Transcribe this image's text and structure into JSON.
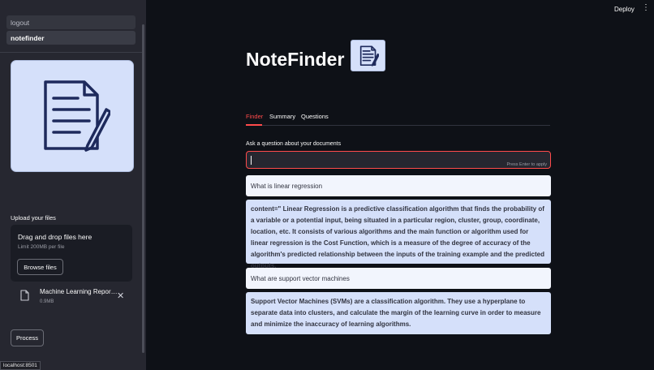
{
  "header": {
    "deploy_label": "Deploy",
    "menu_icon": "kebab-menu-icon"
  },
  "sidebar": {
    "nav": [
      {
        "label": "logout"
      },
      {
        "label": "notefinder"
      }
    ],
    "upload": {
      "label": "Upload your files",
      "dropzone_title": "Drag and drop files here",
      "dropzone_limit": "Limit 200MB per file",
      "browse_label": "Browse files"
    },
    "file": {
      "name": "Machine Learning Repor…",
      "size": "0.9MB"
    },
    "process_label": "Process"
  },
  "main": {
    "title": "NoteFinder",
    "tabs": [
      {
        "label": "Finder",
        "active": true
      },
      {
        "label": "Summary"
      },
      {
        "label": "Questions"
      }
    ],
    "ask": {
      "label": "Ask a question about your documents",
      "hint": "Press Enter to apply",
      "value": ""
    },
    "conversation": [
      {
        "role": "question",
        "text": "What is linear regression"
      },
      {
        "role": "answer",
        "text": "content=\" Linear Regression is a predictive classification algorithm that finds the probability of a variable or a potential input, being situated in a particular region, cluster, group, coordinate, location, etc. It consists of various algorithms and the main function or algorithm used for linear regression is the Cost Function, which is a measure of the degree of accuracy of the algorithm's predicted relationship between the inputs of the training example and the predicted outputs."
      },
      {
        "role": "question",
        "text": "What are support vector machines"
      },
      {
        "role": "answer",
        "text": "Support Vector Machines (SVMs) are a classification algorithm. They use a hyperplane to separate data into clusters, and calculate the margin of the learning curve in order to measure and minimize the inaccuracy of learning algorithms."
      }
    ]
  },
  "status_bar": {
    "url": "localhost:8501"
  },
  "colors": {
    "accent": "#ff4b4b",
    "background": "#0e1117",
    "sidebar": "#262730",
    "bubble_question": "#f2f5fd",
    "bubble_answer": "#d5e0fa",
    "icon_navy": "#1e2a5c"
  }
}
